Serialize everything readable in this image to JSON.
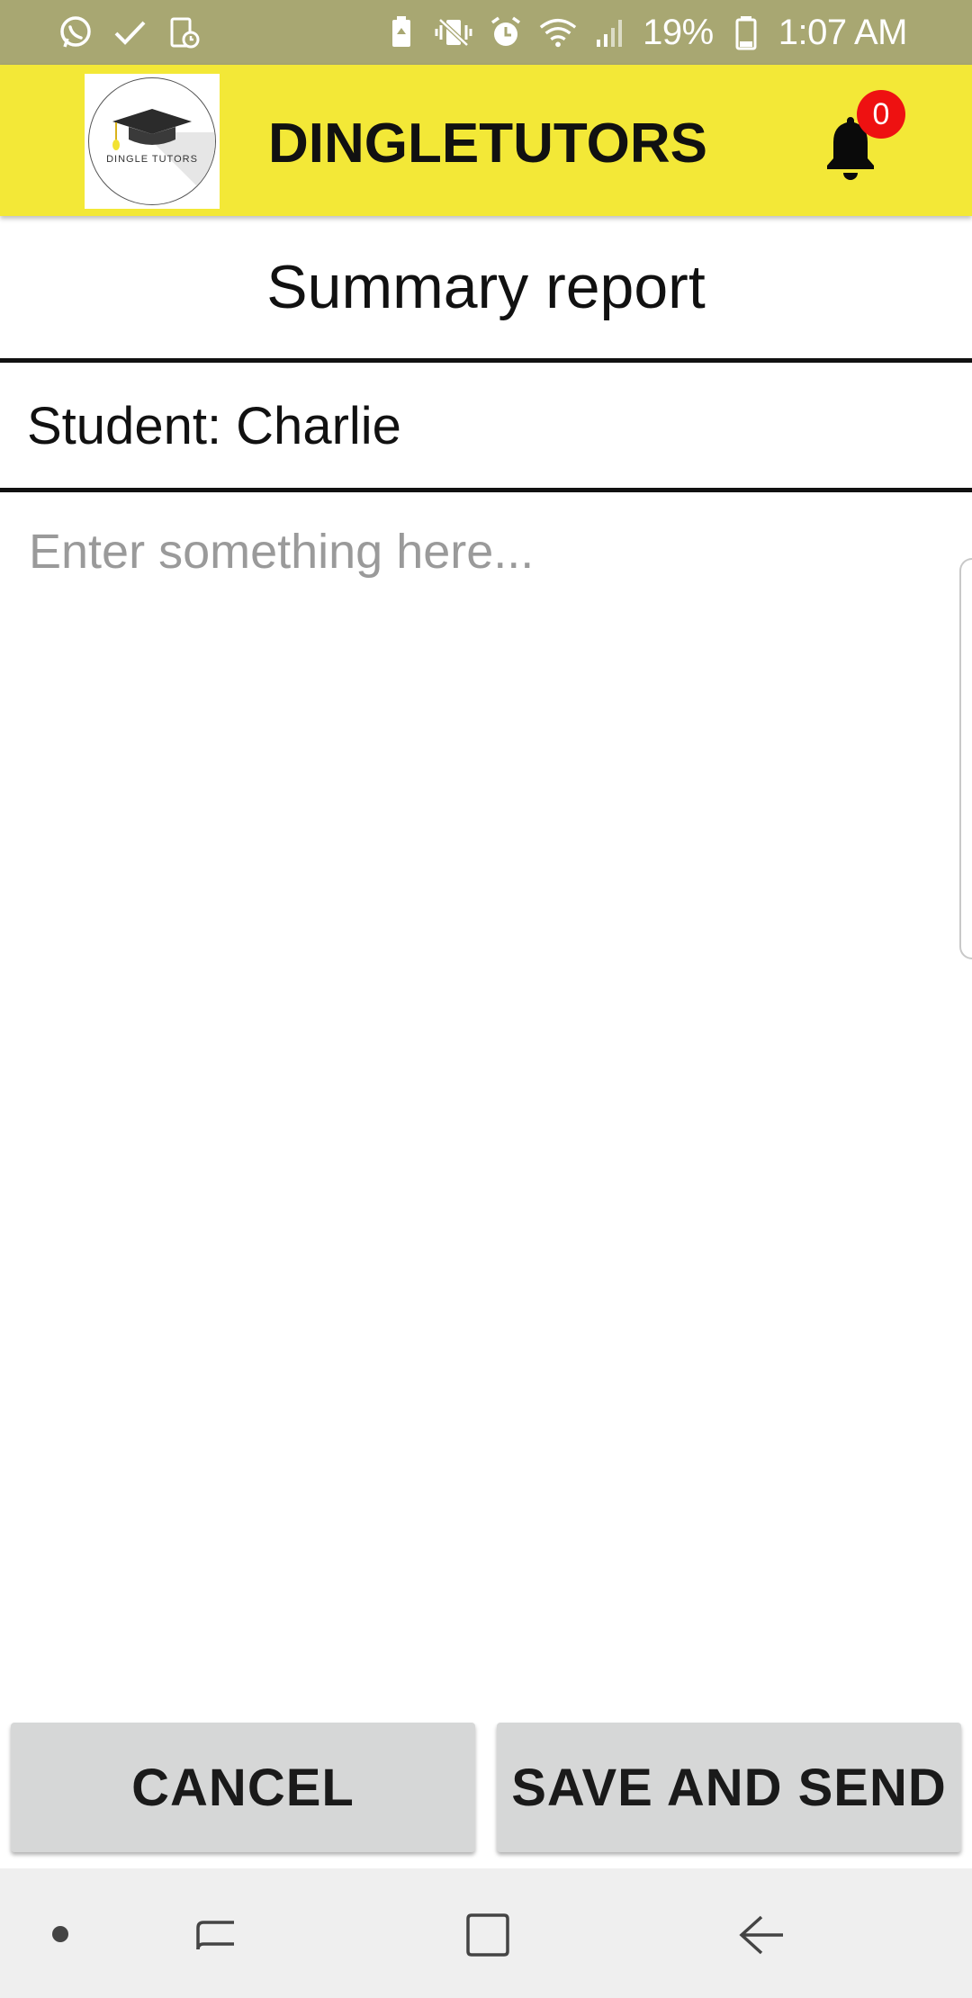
{
  "status_bar": {
    "battery_percent": "19%",
    "time": "1:07 AM",
    "left_icons": [
      "whatsapp-icon",
      "check-icon",
      "screen-timer-icon"
    ],
    "right_icons": [
      "battery-saver-icon",
      "vibrate-mute-icon",
      "alarm-icon",
      "wifi-icon",
      "signal-icon",
      "battery-icon"
    ]
  },
  "app_bar": {
    "logo_text": "DINGLE TUTORS",
    "title": "DINGLETUTORS",
    "notification_count": "0"
  },
  "page": {
    "title": "Summary report",
    "student_label": "Student: Charlie",
    "input_placeholder": "Enter something here...",
    "input_value": ""
  },
  "actions": {
    "cancel_label": "CANCEL",
    "save_send_label": "SAVE AND SEND"
  },
  "nav_bar": {
    "icons": [
      "dot-icon",
      "recent-apps-icon",
      "home-icon",
      "back-icon"
    ]
  },
  "colors": {
    "status_bar": "#a8a772",
    "app_bar": "#f3e837",
    "badge": "#ee1111",
    "button": "#d6d7d7"
  }
}
